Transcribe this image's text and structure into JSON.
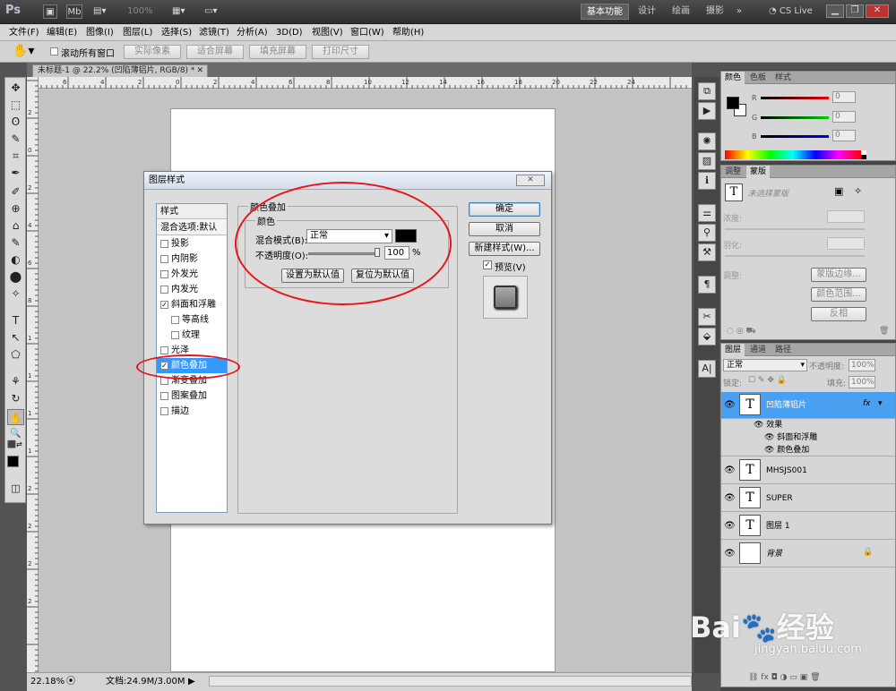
{
  "app": {
    "logo": "Ps",
    "zoom_select": "100%",
    "workspaces": [
      "基本功能",
      "设计",
      "绘画",
      "摄影"
    ],
    "more": "»",
    "cs_live": "CS Live"
  },
  "menu": [
    "文件(F)",
    "编辑(E)",
    "图像(I)",
    "图层(L)",
    "选择(S)",
    "滤镜(T)",
    "分析(A)",
    "3D(D)",
    "视图(V)",
    "窗口(W)",
    "帮助(H)"
  ],
  "options": {
    "scroll_all": "滚动所有窗口",
    "buttons": [
      "实际像素",
      "适合屏幕",
      "填充屏幕",
      "打印尺寸"
    ]
  },
  "document": {
    "tab_title": "未标题-1 @ 22.2% (凹陷薄铝片, RGB/8) *",
    "ruler_top": [
      "6",
      "4",
      "2",
      "0",
      "2",
      "4",
      "6",
      "8",
      "10",
      "12",
      "14",
      "16",
      "18",
      "20",
      "22",
      "24"
    ],
    "ruler_left": [
      "2",
      "0",
      "2",
      "4",
      "6",
      "8",
      "1",
      "1",
      "1",
      "1",
      "2",
      "2",
      "2",
      "2"
    ],
    "zoom": "22.18%",
    "doc_info": "文档:24.9M/3.00M"
  },
  "tools": [
    "✥",
    "⬚",
    "ʘ",
    "✎",
    "⌗",
    "✒",
    "✐",
    "⊕",
    "⌂",
    "✎",
    "◐",
    "⬤",
    "✧",
    "T",
    "↖",
    "⬠",
    "⚘",
    "↻",
    "✋",
    "🔍",
    "⬛",
    "◫"
  ],
  "dialog": {
    "title": "图层样式",
    "styles_header": "样式",
    "blend_default": "混合选项:默认",
    "items": [
      {
        "label": "投影",
        "checked": false
      },
      {
        "label": "内阴影",
        "checked": false
      },
      {
        "label": "外发光",
        "checked": false
      },
      {
        "label": "内发光",
        "checked": false
      },
      {
        "label": "斜面和浮雕",
        "checked": true
      },
      {
        "label": "等高线",
        "checked": false
      },
      {
        "label": "纹理",
        "checked": false
      },
      {
        "label": "光泽",
        "checked": false
      },
      {
        "label": "颜色叠加",
        "checked": true
      },
      {
        "label": "渐变叠加",
        "checked": false
      },
      {
        "label": "图案叠加",
        "checked": false
      },
      {
        "label": "描边",
        "checked": false
      }
    ],
    "section_title": "颜色叠加",
    "group_title": "颜色",
    "blend_mode_label": "混合模式(B):",
    "blend_mode_value": "正常",
    "overlay_color": "#000000",
    "opacity_label": "不透明度(O):",
    "opacity_value": "100",
    "opacity_unit": "%",
    "opacity_fraction": 1.0,
    "set_default": "设置为默认值",
    "reset_default": "复位为默认值",
    "ok": "确定",
    "cancel": "取消",
    "new_style": "新建样式(W)...",
    "preview": "预览(V)",
    "preview_checked": true,
    "close": "✕"
  },
  "color_panel": {
    "tabs": [
      "颜色",
      "色板",
      "样式"
    ],
    "labels": [
      "R",
      "G",
      "B"
    ],
    "values": [
      "0",
      "0",
      "0"
    ],
    "fg": "#000000",
    "bg": "#ffffff"
  },
  "adjust_panel": {
    "tabs": [
      "调整",
      "蒙版"
    ],
    "hint": "未选择蒙版",
    "density": "浓度:",
    "feather": "羽化:",
    "refine": "调整:",
    "buttons": [
      "蒙版边缘...",
      "颜色范围...",
      "反相"
    ]
  },
  "layers_panel": {
    "tabs": [
      "图层",
      "通道",
      "路径"
    ],
    "blend": "正常",
    "opacity_label": "不透明度:",
    "opacity": "100%",
    "lock_label": "锁定:",
    "fill_label": "填充:",
    "fill": "100%",
    "layers": [
      {
        "name": "凹陷薄铝片",
        "type": "T",
        "selected": true,
        "fx": "fx"
      },
      {
        "name": "MHSJS001",
        "type": "T",
        "selected": false
      },
      {
        "name": "SUPER",
        "type": "T",
        "selected": false
      },
      {
        "name": "图层 1",
        "type": "T",
        "selected": false
      },
      {
        "name": "背景",
        "type": "",
        "selected": false
      }
    ],
    "effects_label": "效果",
    "effects": [
      "斜面和浮雕",
      "颜色叠加"
    ]
  },
  "watermark": {
    "brand": "Bai",
    "brand2": "经验",
    "url": "jingyan.baidu.com"
  }
}
